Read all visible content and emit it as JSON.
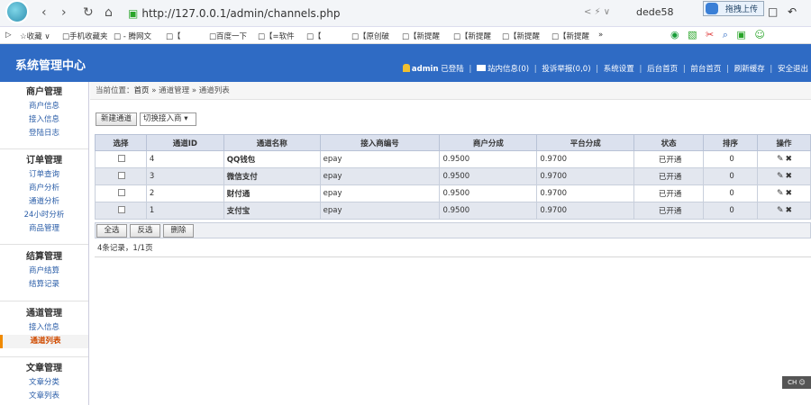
{
  "browser": {
    "url": "http://127.0.0.1/admin/channels.php",
    "url_right": "< ⚡ ∨",
    "user": "dede58",
    "upload_label": "拖拽上传"
  },
  "bookmarks": [
    "▷",
    "☆收藏 ∨",
    "□手机收藏夹",
    "□ - 腾网文",
    "□【",
    "□百度一下",
    "□【=软件",
    "□【",
    "□【原创破",
    "□【新提醒",
    "□【新提醒",
    "□【新提醒",
    "□【新提醒",
    "»"
  ],
  "header": {
    "title": "系统管理中心",
    "admin_name": "admin",
    "admin_status": "已登陆",
    "links": [
      "站内信息(0)",
      "投诉举报(0,0)",
      "系统设置",
      "后台首页",
      "前台首页",
      "刷新缓存",
      "安全退出"
    ]
  },
  "sidebar": [
    {
      "title": "商户管理",
      "items": [
        "商户信息",
        "接入信息",
        "登陆日志"
      ]
    },
    {
      "title": "订单管理",
      "items": [
        "订单查询",
        "商户分析",
        "通道分析",
        "24小时分析",
        "商品管理"
      ]
    },
    {
      "title": "结算管理",
      "items": [
        "商户结算",
        "结算记录"
      ]
    },
    {
      "title": "通道管理",
      "items": [
        "接入信息",
        "通道列表"
      ]
    },
    {
      "title": "文章管理",
      "items": [
        "文章分类",
        "文章列表"
      ]
    }
  ],
  "breadcrumb": {
    "prefix": "当前位置：",
    "home": "首页",
    "rest": " » 通道管理 » 通道列表"
  },
  "toolbar": {
    "new_channel": "新建通道",
    "switch_provider": "切换接入商 ▾"
  },
  "table": {
    "headers": [
      "选择",
      "通道ID",
      "通道名称",
      "接入商编号",
      "商户分成",
      "平台分成",
      "状态",
      "排序",
      "操作"
    ],
    "rows": [
      {
        "id": "4",
        "name": "QQ钱包",
        "provider": "epay",
        "merchant_share": "0.9500",
        "platform_share": "0.9700",
        "status": "已开通",
        "sort": "0"
      },
      {
        "id": "3",
        "name": "微信支付",
        "provider": "epay",
        "merchant_share": "0.9500",
        "platform_share": "0.9700",
        "status": "已开通",
        "sort": "0"
      },
      {
        "id": "2",
        "name": "财付通",
        "provider": "epay",
        "merchant_share": "0.9500",
        "platform_share": "0.9700",
        "status": "已开通",
        "sort": "0"
      },
      {
        "id": "1",
        "name": "支付宝",
        "provider": "epay",
        "merchant_share": "0.9500",
        "platform_share": "0.9700",
        "status": "已开通",
        "sort": "0"
      }
    ],
    "actions": {
      "select_all": "全选",
      "invert": "反选",
      "delete": "删除"
    }
  },
  "records": "4条记录，1/1页",
  "ime": "CH ☺",
  "colors": {
    "header_bg": "#2f6bc4",
    "status_on": "#1f9a1f",
    "active_marker": "#f08a00"
  }
}
